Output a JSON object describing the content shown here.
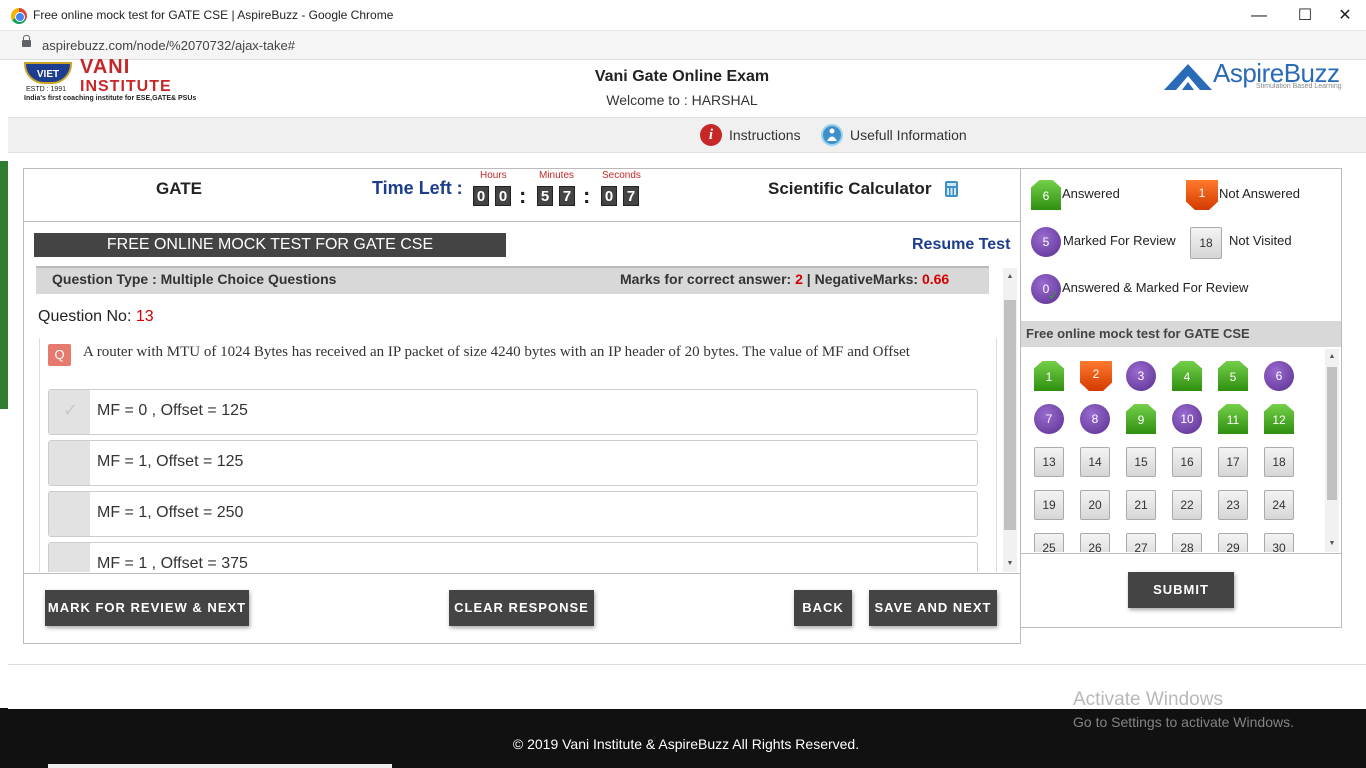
{
  "browser": {
    "tab_title": "Free online mock test for GATE CSE | AspireBuzz - Google Chrome",
    "url": "aspirebuzz.com/node/%2070732/ajax-take#",
    "minimize": "—",
    "maximize": "☐",
    "close": "✕"
  },
  "header": {
    "left_logo": {
      "badge": "VIET",
      "estd": "ESTD : 1991",
      "name_top": "VANI",
      "name_bottom": "INSTITUTE",
      "tagline": "India's first coaching institute for ESE,GATE& PSUs"
    },
    "exam_title": "Vani Gate Online Exam",
    "welcome": "Welcome to :   HARSHAL",
    "right_logo": {
      "name": "AspireBuzz",
      "tagline": "Stimulation Based Learning"
    }
  },
  "info_bar": {
    "instructions": "Instructions",
    "useful_info": "Usefull Information",
    "info_icon": "i"
  },
  "exam": {
    "subject": "GATE",
    "time_left_label": "Time Left :",
    "timer_units": {
      "hours": "Hours",
      "minutes": "Minutes",
      "seconds": "Seconds"
    },
    "timer": {
      "h1": "0",
      "h2": "0",
      "m1": "5",
      "m2": "7",
      "s1": "0",
      "s2": "7"
    },
    "calculator": "Scientific Calculator",
    "test_title": "FREE ONLINE MOCK TEST FOR GATE CSE",
    "resume": "Resume Test",
    "question_type": "Question Type : Multiple Choice Questions",
    "marks_label": "Marks for correct answer: ",
    "marks_value": "2",
    "separator": " | ",
    "negative_label": "NegativeMarks: ",
    "negative_value": "0.66",
    "question_no_label": "Question No: ",
    "question_no": "13",
    "question_badge": "Q",
    "question_text": "A router with MTU of 1024 Bytes has received an IP packet of size 4240 bytes with an IP header  of  20 bytes. The value of MF and Offset",
    "options": [
      "MF = 0 , Offset = 125",
      "MF = 1, Offset = 125",
      "MF = 1, Offset = 250",
      "MF = 1 , Offset = 375"
    ],
    "check_mark": "✓",
    "buttons": {
      "mark_review": "MARK FOR REVIEW & NEXT",
      "clear": "CLEAR RESPONSE",
      "back": "BACK",
      "save_next": "SAVE AND NEXT"
    }
  },
  "legend": {
    "answered": {
      "count": "6",
      "label": "Answered"
    },
    "not_answered": {
      "count": "1",
      "label": "Not Answered"
    },
    "marked": {
      "count": "5",
      "label": "Marked For Review"
    },
    "not_visited": {
      "count": "18",
      "label": "Not Visited"
    },
    "answered_marked": {
      "count": "0",
      "label": "Answered & Marked For Review"
    }
  },
  "palette": {
    "section": "Free online mock test for GATE CSE",
    "questions": [
      {
        "n": "1",
        "status": "answered"
      },
      {
        "n": "2",
        "status": "not-answered"
      },
      {
        "n": "3",
        "status": "marked"
      },
      {
        "n": "4",
        "status": "answered"
      },
      {
        "n": "5",
        "status": "answered"
      },
      {
        "n": "6",
        "status": "marked"
      },
      {
        "n": "7",
        "status": "marked"
      },
      {
        "n": "8",
        "status": "marked"
      },
      {
        "n": "9",
        "status": "answered"
      },
      {
        "n": "10",
        "status": "marked"
      },
      {
        "n": "11",
        "status": "answered"
      },
      {
        "n": "12",
        "status": "answered"
      },
      {
        "n": "13",
        "status": "not-visited"
      },
      {
        "n": "14",
        "status": "not-visited"
      },
      {
        "n": "15",
        "status": "not-visited"
      },
      {
        "n": "16",
        "status": "not-visited"
      },
      {
        "n": "17",
        "status": "not-visited"
      },
      {
        "n": "18",
        "status": "not-visited"
      },
      {
        "n": "19",
        "status": "not-visited"
      },
      {
        "n": "20",
        "status": "not-visited"
      },
      {
        "n": "21",
        "status": "not-visited"
      },
      {
        "n": "22",
        "status": "not-visited"
      },
      {
        "n": "23",
        "status": "not-visited"
      },
      {
        "n": "24",
        "status": "not-visited"
      },
      {
        "n": "25",
        "status": "not-visited"
      },
      {
        "n": "26",
        "status": "not-visited"
      },
      {
        "n": "27",
        "status": "not-visited"
      },
      {
        "n": "28",
        "status": "not-visited"
      },
      {
        "n": "29",
        "status": "not-visited"
      },
      {
        "n": "30",
        "status": "not-visited"
      }
    ],
    "submit": "SUBMIT",
    "up_arrow": "▲",
    "down_arrow": "▼"
  },
  "footer": {
    "copyright": "© 2019 Vani Institute & AspireBuzz All Rights Reserved."
  },
  "watermark": {
    "title": "Activate Windows",
    "subtitle": "Go to Settings to activate Windows."
  },
  "colors": {
    "answered": "#2f8f0f",
    "not_answered": "#d33a00",
    "marked": "#5a2f91",
    "accent": "#1d3d8f",
    "highlight": "#d50000"
  }
}
